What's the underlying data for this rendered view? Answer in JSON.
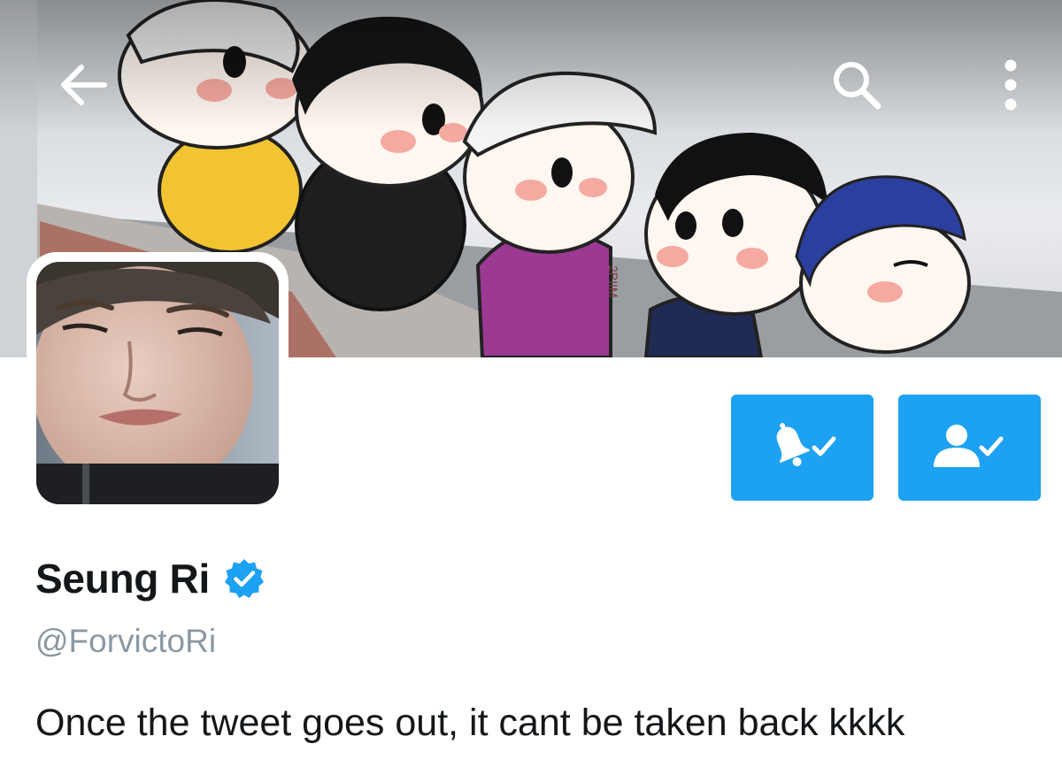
{
  "header": {
    "back_icon": "arrow-left-icon",
    "search_icon": "search-icon",
    "more_icon": "more-vertical-icon",
    "banner_watermark": "2PIIM"
  },
  "profile": {
    "display_name": "Seung Ri",
    "verified": true,
    "verified_icon": "verified-badge-icon",
    "handle": "@ForvictoRi",
    "bio": "Once the tweet goes out, it cant be taken back kkkk"
  },
  "actions": {
    "notifications_icon": "bell-check-icon",
    "following_icon": "user-check-icon"
  },
  "colors": {
    "accent": "#1da1f2",
    "text_primary": "#14171a",
    "text_secondary": "#8b98a3"
  }
}
